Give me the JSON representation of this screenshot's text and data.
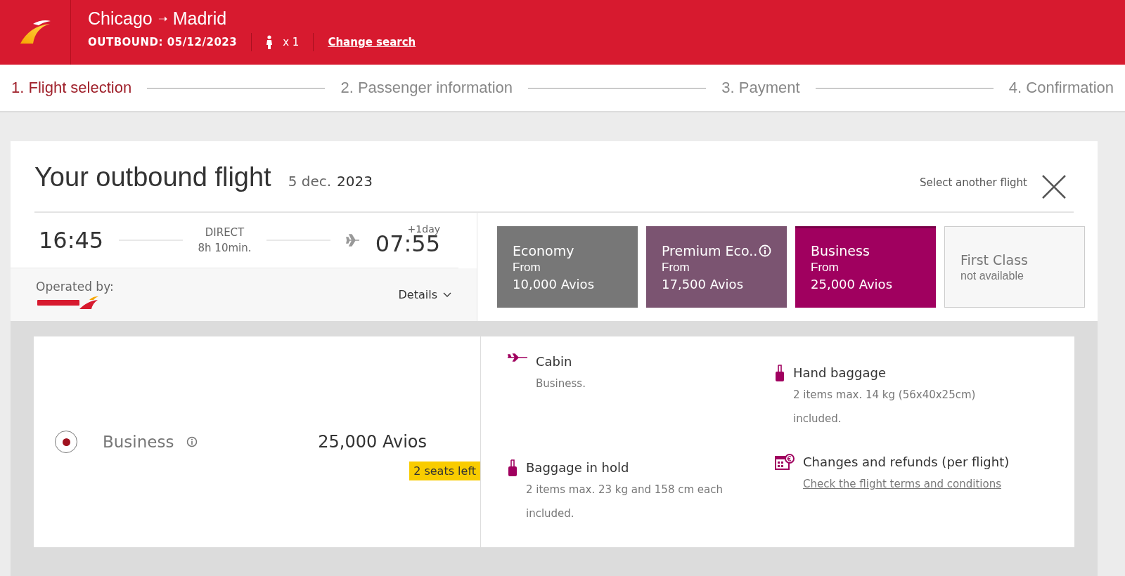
{
  "header": {
    "route_from": "Chicago",
    "route_arrow": "➝",
    "route_to": "Madrid",
    "outbound": "OUTBOUND: 05/12/2023",
    "passengers": "x 1",
    "change_search": "Change search"
  },
  "steps": [
    {
      "label": "1. Flight selection",
      "selected": true
    },
    {
      "label": "2. Passenger information",
      "selected": false
    },
    {
      "label": "3. Payment",
      "selected": false
    },
    {
      "label": "4. Confirmation",
      "selected": false
    }
  ],
  "flight": {
    "title": "Your outbound flight",
    "date_day": "5 dec.",
    "date_year": "2023",
    "select_another": "Select another flight",
    "depart": "16:45",
    "type": "DIRECT",
    "duration": "8h 10min.",
    "arrive": "07:55",
    "day_offset": "+1day",
    "operated_by": "Operated by:",
    "details": "Details"
  },
  "fares": [
    {
      "name": "Economy",
      "from": "From",
      "price": "10,000 Avios",
      "color": "#777777",
      "info": false,
      "selected": false,
      "available": true
    },
    {
      "name": "Premium Eco..",
      "from": "From",
      "price": "17,500 Avios",
      "color": "#7b5471",
      "info": true,
      "selected": false,
      "available": true
    },
    {
      "name": "Business",
      "from": "From",
      "price": "25,000 Avios",
      "color": "#a0005f",
      "info": false,
      "selected": true,
      "available": true
    },
    {
      "name": "First Class",
      "note": "not available",
      "info": false,
      "selected": false,
      "available": false
    }
  ],
  "option": {
    "name": "Business",
    "selected": true,
    "price": "25,000 Avios",
    "seats": "2 seats left"
  },
  "benefits": [
    {
      "kind": "plane",
      "title": "Cabin",
      "lines": [
        "Business."
      ]
    },
    {
      "kind": "handbag",
      "title": "Hand baggage",
      "lines": [
        "2 items max. 14 kg (56x40x25cm)",
        "included."
      ]
    },
    {
      "kind": "suitcase",
      "title": "Baggage in hold",
      "lines": [
        "2 items max. 23 kg and 158 cm each",
        "included."
      ]
    },
    {
      "kind": "calendar",
      "title": "Changes and refunds (per flight)",
      "link": "Check the flight terms and conditions"
    }
  ]
}
